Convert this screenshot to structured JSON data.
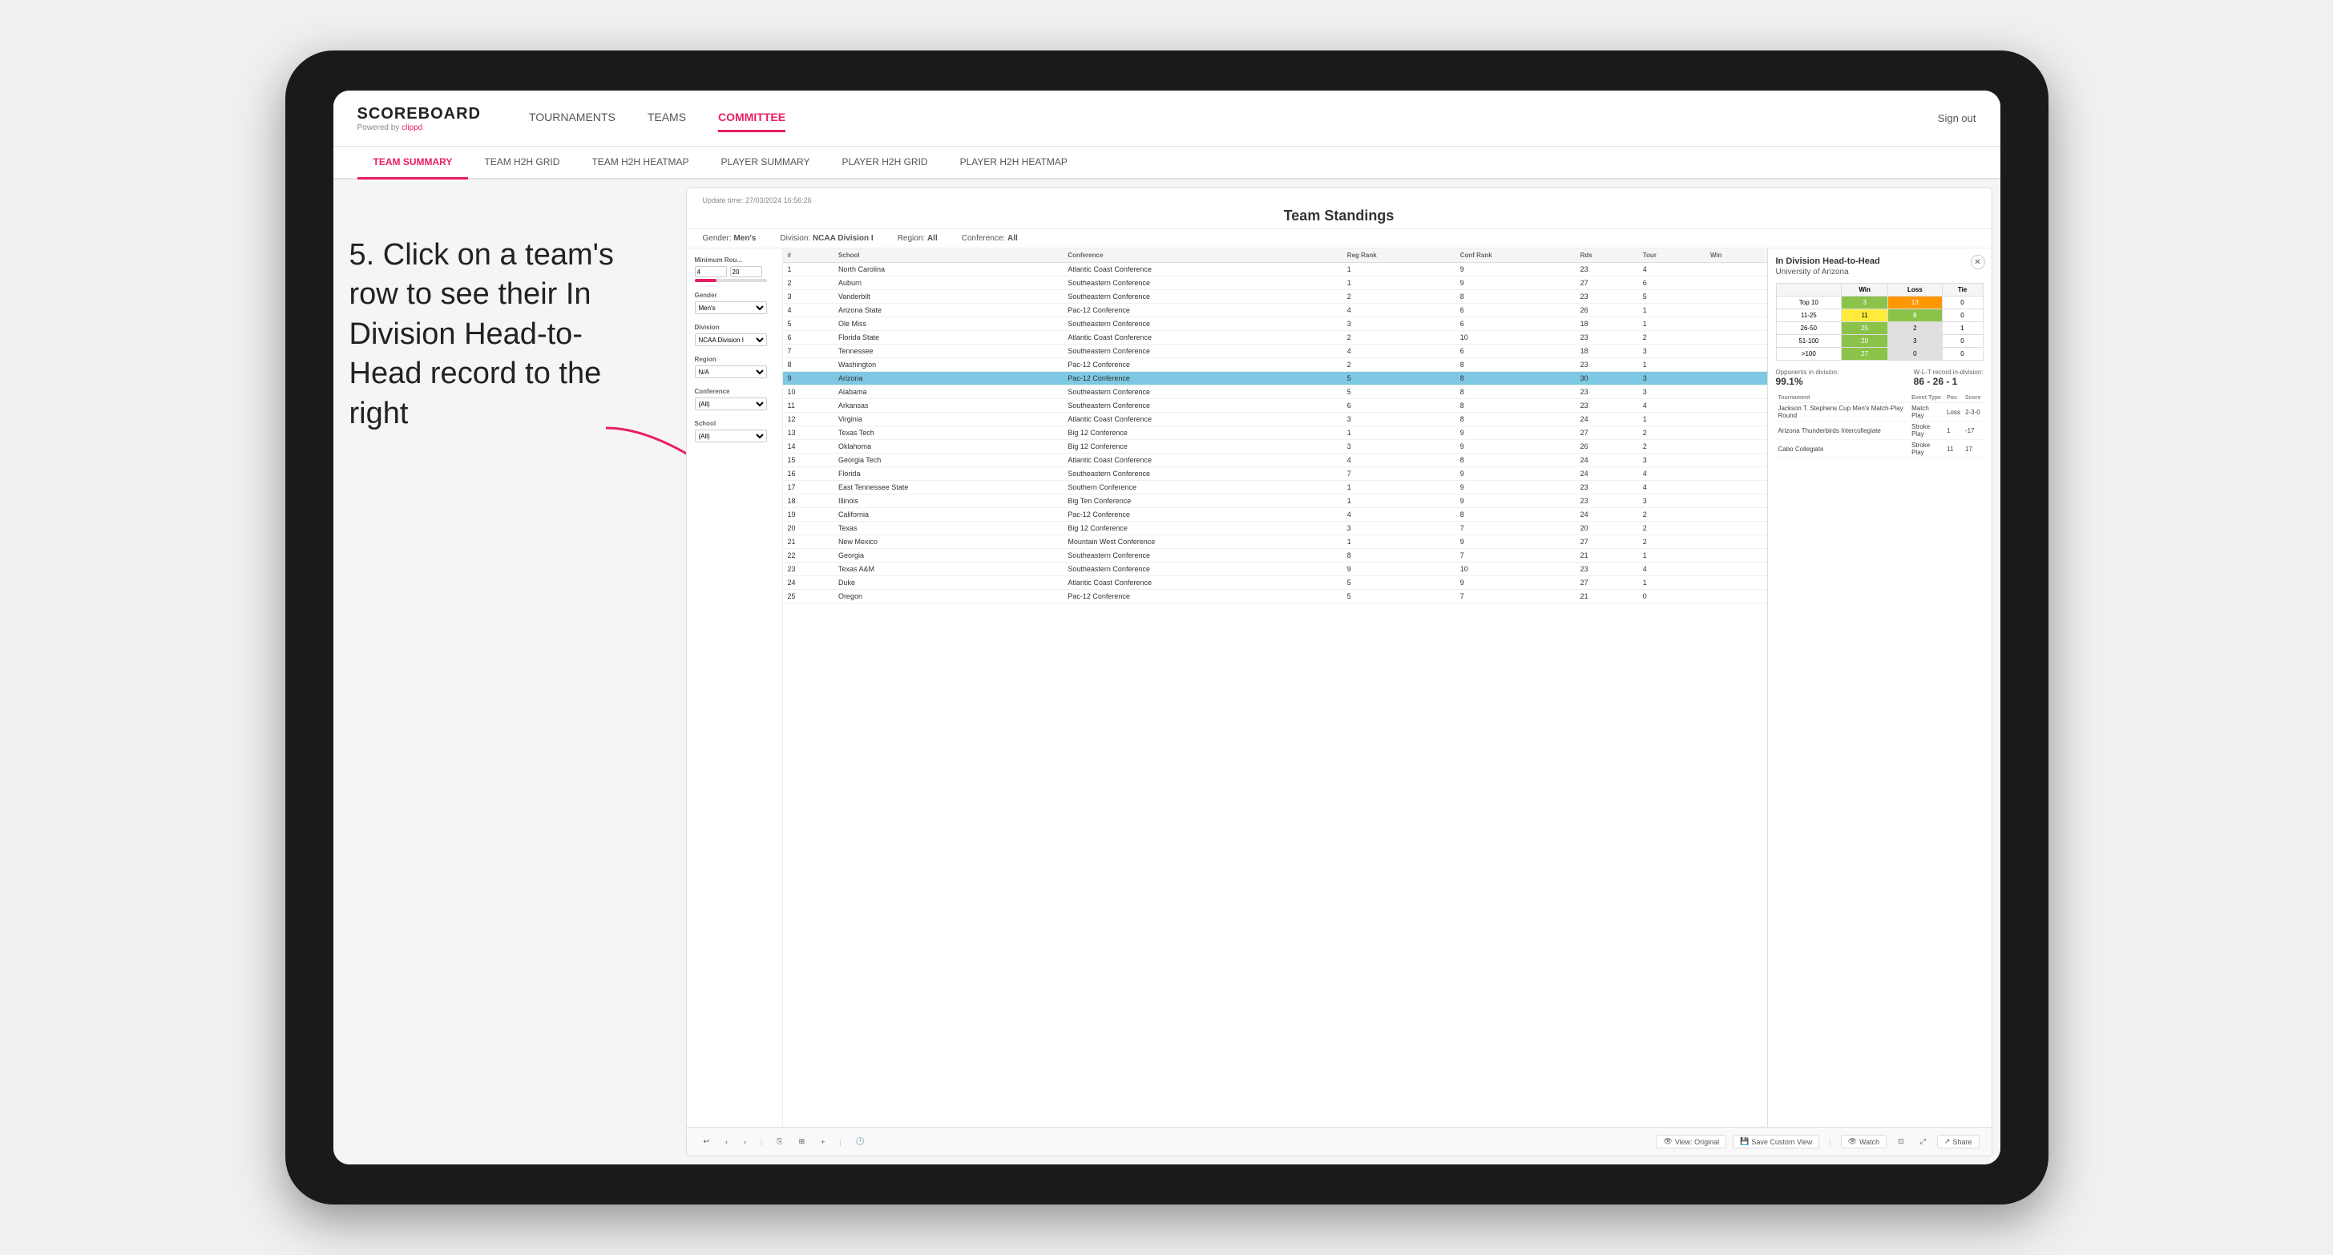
{
  "page": {
    "background": "#f0f0f0"
  },
  "logo": {
    "text": "SCOREBOARD",
    "sub_text": "Powered by ",
    "sub_brand": "clippd"
  },
  "top_nav": {
    "items": [
      {
        "label": "TOURNAMENTS",
        "active": false
      },
      {
        "label": "TEAMS",
        "active": false
      },
      {
        "label": "COMMITTEE",
        "active": true
      }
    ],
    "sign_out": "Sign out"
  },
  "sub_nav": {
    "items": [
      {
        "label": "TEAM SUMMARY",
        "active": true
      },
      {
        "label": "TEAM H2H GRID",
        "active": false
      },
      {
        "label": "TEAM H2H HEATMAP",
        "active": false
      },
      {
        "label": "PLAYER SUMMARY",
        "active": false
      },
      {
        "label": "PLAYER H2H GRID",
        "active": false
      },
      {
        "label": "PLAYER H2H HEATMAP",
        "active": false
      }
    ]
  },
  "annotation": {
    "text": "5. Click on a team's row to see their In Division Head-to-Head record to the right"
  },
  "panel": {
    "update_time": "Update time: 27/03/2024 16:56:26",
    "title": "Team Standings",
    "filters": {
      "gender": "Men's",
      "division": "NCAA Division I",
      "region": "All",
      "conference": "All"
    }
  },
  "left_filters": {
    "min_rounds_label": "Minimum Rou...",
    "min_rounds_val1": "4",
    "min_rounds_val2": "20",
    "gender_label": "Gender",
    "gender_val": "Men's",
    "division_label": "Division",
    "division_val": "NCAA Division I",
    "region_label": "Region",
    "region_val": "N/A",
    "conference_label": "Conference",
    "conference_val": "(All)",
    "school_label": "School",
    "school_val": "(All)"
  },
  "table": {
    "columns": [
      "#",
      "School",
      "Conference",
      "Reg Rank",
      "Conf Rank",
      "Rds",
      "Tour",
      "Win"
    ],
    "rows": [
      {
        "rank": 1,
        "school": "North Carolina",
        "conference": "Atlantic Coast Conference",
        "reg_rank": 1,
        "conf_rank": 9,
        "rds": 23,
        "tour": 4,
        "win": null
      },
      {
        "rank": 2,
        "school": "Auburn",
        "conference": "Southeastern Conference",
        "reg_rank": 1,
        "conf_rank": 9,
        "rds": 27,
        "tour": 6,
        "win": null
      },
      {
        "rank": 3,
        "school": "Vanderbilt",
        "conference": "Southeastern Conference",
        "reg_rank": 2,
        "conf_rank": 8,
        "rds": 23,
        "tour": 5,
        "win": null
      },
      {
        "rank": 4,
        "school": "Arizona State",
        "conference": "Pac-12 Conference",
        "reg_rank": 4,
        "conf_rank": 6,
        "rds": 26,
        "tour": 1,
        "win": null
      },
      {
        "rank": 5,
        "school": "Ole Miss",
        "conference": "Southeastern Conference",
        "reg_rank": 3,
        "conf_rank": 6,
        "rds": 18,
        "tour": 1,
        "win": null
      },
      {
        "rank": 6,
        "school": "Florida State",
        "conference": "Atlantic Coast Conference",
        "reg_rank": 2,
        "conf_rank": 10,
        "rds": 23,
        "tour": 2,
        "win": null
      },
      {
        "rank": 7,
        "school": "Tennessee",
        "conference": "Southeastern Conference",
        "reg_rank": 4,
        "conf_rank": 6,
        "rds": 18,
        "tour": 3,
        "win": null
      },
      {
        "rank": 8,
        "school": "Washington",
        "conference": "Pac-12 Conference",
        "reg_rank": 2,
        "conf_rank": 8,
        "rds": 23,
        "tour": 1,
        "win": null
      },
      {
        "rank": 9,
        "school": "Arizona",
        "conference": "Pac-12 Conference",
        "reg_rank": 5,
        "conf_rank": 8,
        "rds": 30,
        "tour": 3,
        "win": null,
        "highlighted": true
      },
      {
        "rank": 10,
        "school": "Alabama",
        "conference": "Southeastern Conference",
        "reg_rank": 5,
        "conf_rank": 8,
        "rds": 23,
        "tour": 3,
        "win": null
      },
      {
        "rank": 11,
        "school": "Arkansas",
        "conference": "Southeastern Conference",
        "reg_rank": 6,
        "conf_rank": 8,
        "rds": 23,
        "tour": 4,
        "win": null
      },
      {
        "rank": 12,
        "school": "Virginia",
        "conference": "Atlantic Coast Conference",
        "reg_rank": 3,
        "conf_rank": 8,
        "rds": 24,
        "tour": 1,
        "win": null
      },
      {
        "rank": 13,
        "school": "Texas Tech",
        "conference": "Big 12 Conference",
        "reg_rank": 1,
        "conf_rank": 9,
        "rds": 27,
        "tour": 2,
        "win": null
      },
      {
        "rank": 14,
        "school": "Oklahoma",
        "conference": "Big 12 Conference",
        "reg_rank": 3,
        "conf_rank": 9,
        "rds": 26,
        "tour": 2,
        "win": null
      },
      {
        "rank": 15,
        "school": "Georgia Tech",
        "conference": "Atlantic Coast Conference",
        "reg_rank": 4,
        "conf_rank": 8,
        "rds": 24,
        "tour": 3,
        "win": null
      },
      {
        "rank": 16,
        "school": "Florida",
        "conference": "Southeastern Conference",
        "reg_rank": 7,
        "conf_rank": 9,
        "rds": 24,
        "tour": 4,
        "win": null
      },
      {
        "rank": 17,
        "school": "East Tennessee State",
        "conference": "Southern Conference",
        "reg_rank": 1,
        "conf_rank": 9,
        "rds": 23,
        "tour": 4,
        "win": null
      },
      {
        "rank": 18,
        "school": "Illinois",
        "conference": "Big Ten Conference",
        "reg_rank": 1,
        "conf_rank": 9,
        "rds": 23,
        "tour": 3,
        "win": null
      },
      {
        "rank": 19,
        "school": "California",
        "conference": "Pac-12 Conference",
        "reg_rank": 4,
        "conf_rank": 8,
        "rds": 24,
        "tour": 2,
        "win": null
      },
      {
        "rank": 20,
        "school": "Texas",
        "conference": "Big 12 Conference",
        "reg_rank": 3,
        "conf_rank": 7,
        "rds": 20,
        "tour": 2,
        "win": null
      },
      {
        "rank": 21,
        "school": "New Mexico",
        "conference": "Mountain West Conference",
        "reg_rank": 1,
        "conf_rank": 9,
        "rds": 27,
        "tour": 2,
        "win": null
      },
      {
        "rank": 22,
        "school": "Georgia",
        "conference": "Southeastern Conference",
        "reg_rank": 8,
        "conf_rank": 7,
        "rds": 21,
        "tour": 1,
        "win": null
      },
      {
        "rank": 23,
        "school": "Texas A&M",
        "conference": "Southeastern Conference",
        "reg_rank": 9,
        "conf_rank": 10,
        "rds": 23,
        "tour": 4,
        "win": null
      },
      {
        "rank": 24,
        "school": "Duke",
        "conference": "Atlantic Coast Conference",
        "reg_rank": 5,
        "conf_rank": 9,
        "rds": 27,
        "tour": 1,
        "win": null
      },
      {
        "rank": 25,
        "school": "Oregon",
        "conference": "Pac-12 Conference",
        "reg_rank": 5,
        "conf_rank": 7,
        "rds": 21,
        "tour": 0,
        "win": null
      }
    ]
  },
  "h2h": {
    "title": "In Division Head-to-Head",
    "team": "University of Arizona",
    "grid_headers": [
      "",
      "Win",
      "Loss",
      "Tie"
    ],
    "grid_rows": [
      {
        "label": "Top 10",
        "win": 3,
        "loss": 13,
        "tie": 0,
        "win_color": "green",
        "loss_color": "orange"
      },
      {
        "label": "11-25",
        "win": 11,
        "loss": 8,
        "tie": 0,
        "win_color": "yellow",
        "loss_color": "green"
      },
      {
        "label": "26-50",
        "win": 25,
        "loss": 2,
        "tie": 1,
        "win_color": "green",
        "loss_color": "gray"
      },
      {
        "label": "51-100",
        "win": 20,
        "loss": 3,
        "tie": 0,
        "win_color": "green",
        "loss_color": "gray"
      },
      {
        "label": ">100",
        "win": 27,
        "loss": 0,
        "tie": 0,
        "win_color": "green",
        "loss_color": "gray"
      }
    ],
    "opponents_label": "Opponents in division:",
    "opponents_val": "99.1%",
    "record_label": "W-L-T record in-division:",
    "record_val": "86 - 26 - 1",
    "tournament_headers": [
      "Tournament",
      "Event Type",
      "Pos",
      "Score"
    ],
    "tournaments": [
      {
        "name": "Jackson T. Stephens Cup Men's Match-Play Round",
        "event_type": "Match Play",
        "pos": "Loss",
        "score": "2-3-0",
        "extra": "1"
      },
      {
        "name": "Arizona Thunderbirds Intercollegiate",
        "event_type": "Stroke Play",
        "pos": "1",
        "score": "-17"
      },
      {
        "name": "Cabo Collegiate",
        "event_type": "Stroke Play",
        "pos": "11",
        "score": "17"
      }
    ]
  },
  "toolbar": {
    "undo": "↩",
    "redo": "↪",
    "copy": "⎘",
    "view_original": "View: Original",
    "save_custom": "Save Custom View",
    "watch": "Watch",
    "share": "Share"
  }
}
